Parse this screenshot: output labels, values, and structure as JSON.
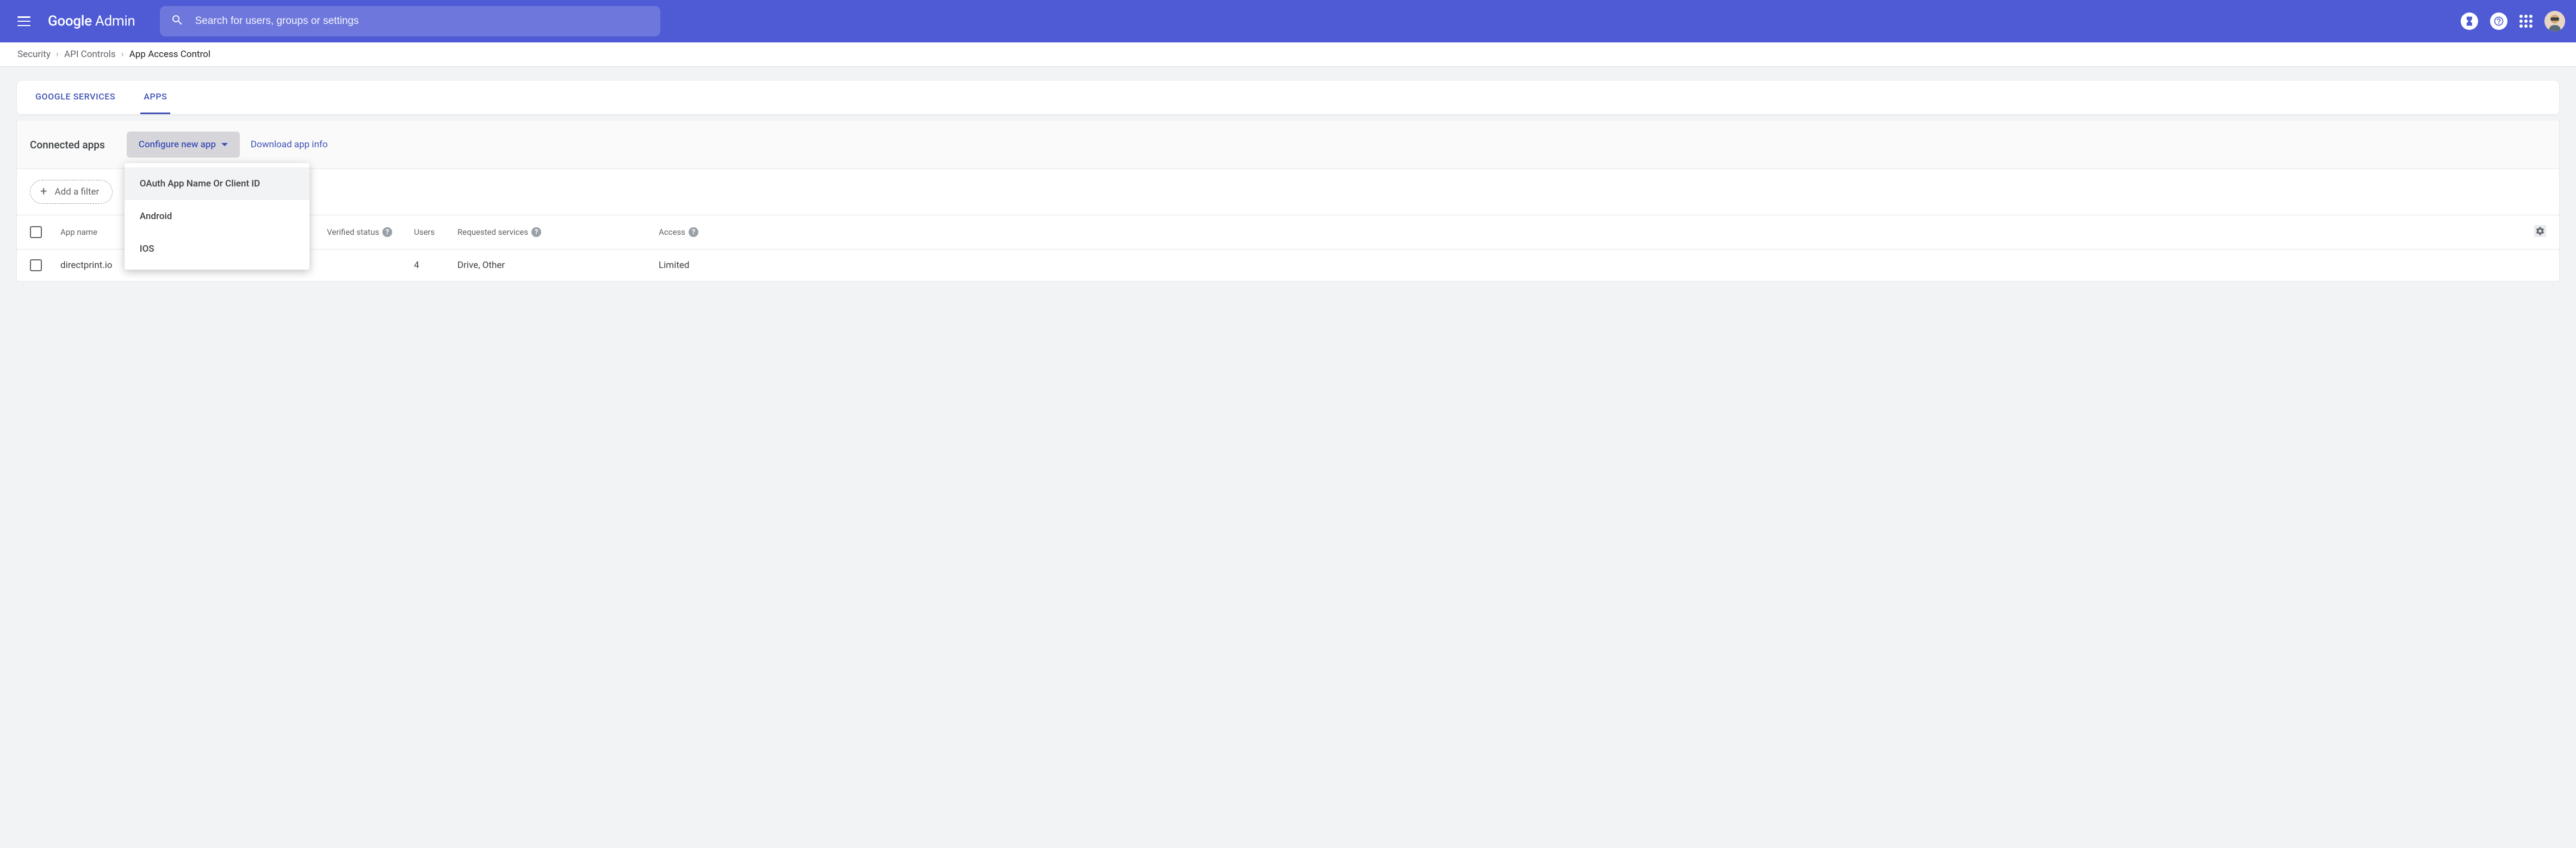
{
  "header": {
    "logo_prefix": "Google",
    "logo_suffix": " Admin",
    "search_placeholder": "Search for users, groups or settings"
  },
  "breadcrumb": {
    "items": [
      "Security",
      "API Controls"
    ],
    "current": "App Access Control"
  },
  "tabs": {
    "items": [
      {
        "label": "GOOGLE SERVICES",
        "active": false
      },
      {
        "label": "APPS",
        "active": true
      }
    ]
  },
  "toolbar": {
    "title": "Connected apps",
    "configure_label": "Configure new app",
    "download_label": "Download app info",
    "dropdown": {
      "items": [
        {
          "label": "OAuth App Name Or Client ID",
          "hover": true
        },
        {
          "label": "Android",
          "hover": false
        },
        {
          "label": "IOS",
          "hover": false
        }
      ]
    }
  },
  "filter": {
    "add_label": "Add a filter"
  },
  "table": {
    "columns": {
      "app_name": "App name",
      "verified": "Verified status",
      "users": "Users",
      "services": "Requested services",
      "access": "Access"
    },
    "rows": [
      {
        "app_name": "directprint.io",
        "verified": "",
        "users": "4",
        "services": "Drive, Other",
        "access": "Limited"
      }
    ]
  }
}
